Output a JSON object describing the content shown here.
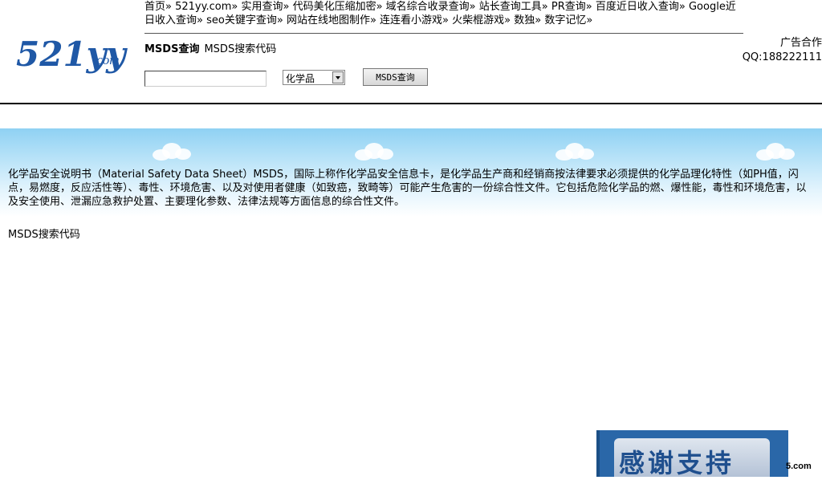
{
  "logo": {
    "text": "521yy",
    "suffix": ".com"
  },
  "nav": {
    "items": [
      "首页»",
      "521yy.com»",
      "实用查询»",
      "代码美化压缩加密»",
      "域名综合收录查询»",
      "站长查询工具»",
      "PR查询»",
      "百度近日收入查询»",
      "Google近日收入查询»",
      "seo关键字查询»",
      "网站在线地图制作»",
      "连连看小游戏»",
      "火柴棍游戏»",
      "数独»",
      "数字记忆»"
    ]
  },
  "subtitle": {
    "bold": "MSDS查询",
    "rest": "MSDS搜索代码"
  },
  "ad": {
    "line1": "广告合作",
    "line2": "QQ:188222111"
  },
  "search": {
    "value": "",
    "placeholder": "",
    "category": "化学品",
    "button_label": "MSDS查询"
  },
  "content": {
    "intro": "化学品安全说明书（Material Safety Data Sheet）MSDS，国际上称作化学品安全信息卡，是化学品生产商和经销商按法律要求必须提供的化学品理化特性（如PH值，闪点，易燃度，反应活性等）、毒性、环境危害、以及对使用者健康（如致癌，致畸等）可能产生危害的一份综合性文件。它包括危险化学品的燃、爆性能，毒性和环境危害，以及安全使用、泄漏应急救护处置、主要理化参数、法律法规等方面信息的综合性文件。",
    "section_title": "MSDS搜索代码"
  },
  "thanks": {
    "text": "感谢支持",
    "domain": "5.com"
  },
  "colors": {
    "logo_blue": "#1f58a6",
    "sky_top": "#8fd1f3",
    "banner_blue": "#2a67a8"
  }
}
